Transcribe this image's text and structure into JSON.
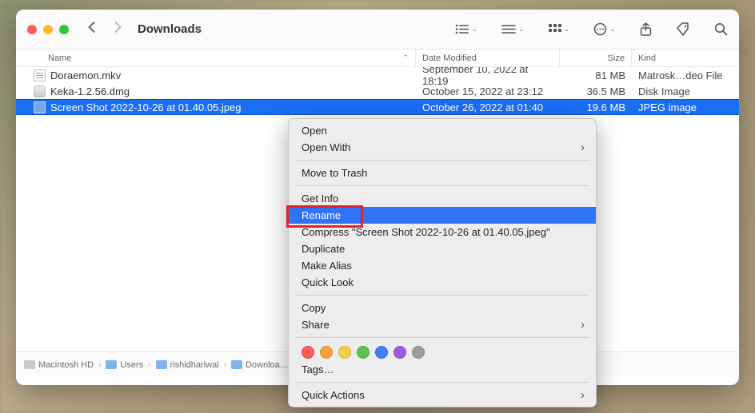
{
  "window": {
    "title": "Downloads"
  },
  "columns": {
    "name": "Name",
    "date": "Date Modified",
    "size": "Size",
    "kind": "Kind"
  },
  "files": [
    {
      "name": "Doraemon.mkv",
      "date": "September 10, 2022 at 18:19",
      "size": "81 MB",
      "kind": "Matrosk…deo File",
      "icon": "doc",
      "selected": false
    },
    {
      "name": "Keka-1.2.56.dmg",
      "date": "October 15, 2022 at 23:12",
      "size": "36.5 MB",
      "kind": "Disk Image",
      "icon": "dmg",
      "selected": false
    },
    {
      "name": "Screen Shot 2022-10-26 at 01.40.05.jpeg",
      "date": "October 26, 2022 at 01:40",
      "size": "19.6 MB",
      "kind": "JPEG image",
      "icon": "doc",
      "selected": true
    }
  ],
  "context_menu": {
    "items": [
      {
        "label": "Open",
        "submenu": false
      },
      {
        "label": "Open With",
        "submenu": true
      },
      {
        "sep": true
      },
      {
        "label": "Move to Trash",
        "submenu": false
      },
      {
        "sep": true
      },
      {
        "label": "Get Info",
        "submenu": false
      },
      {
        "label": "Rename",
        "submenu": false,
        "highlight": true
      },
      {
        "label": "Compress \"Screen Shot 2022-10-26 at 01.40.05.jpeg\"",
        "submenu": false
      },
      {
        "label": "Duplicate",
        "submenu": false
      },
      {
        "label": "Make Alias",
        "submenu": false
      },
      {
        "label": "Quick Look",
        "submenu": false
      },
      {
        "sep": true
      },
      {
        "label": "Copy",
        "submenu": false
      },
      {
        "label": "Share",
        "submenu": true
      },
      {
        "sep": true
      },
      {
        "tags": true,
        "colors": [
          "#ff5b56",
          "#f9a23b",
          "#f7cf40",
          "#5ec251",
          "#3b82f6",
          "#a25ae6",
          "#9d9d9d"
        ]
      },
      {
        "label": "Tags…",
        "submenu": false
      },
      {
        "sep": true
      },
      {
        "label": "Quick Actions",
        "submenu": true
      }
    ]
  },
  "pathbar": [
    {
      "label": "Macintosh HD",
      "icon": "hd"
    },
    {
      "label": "Users",
      "icon": "folder"
    },
    {
      "label": "rishidhariwal",
      "icon": "folder"
    },
    {
      "label": "Downloa…",
      "icon": "folder"
    }
  ]
}
